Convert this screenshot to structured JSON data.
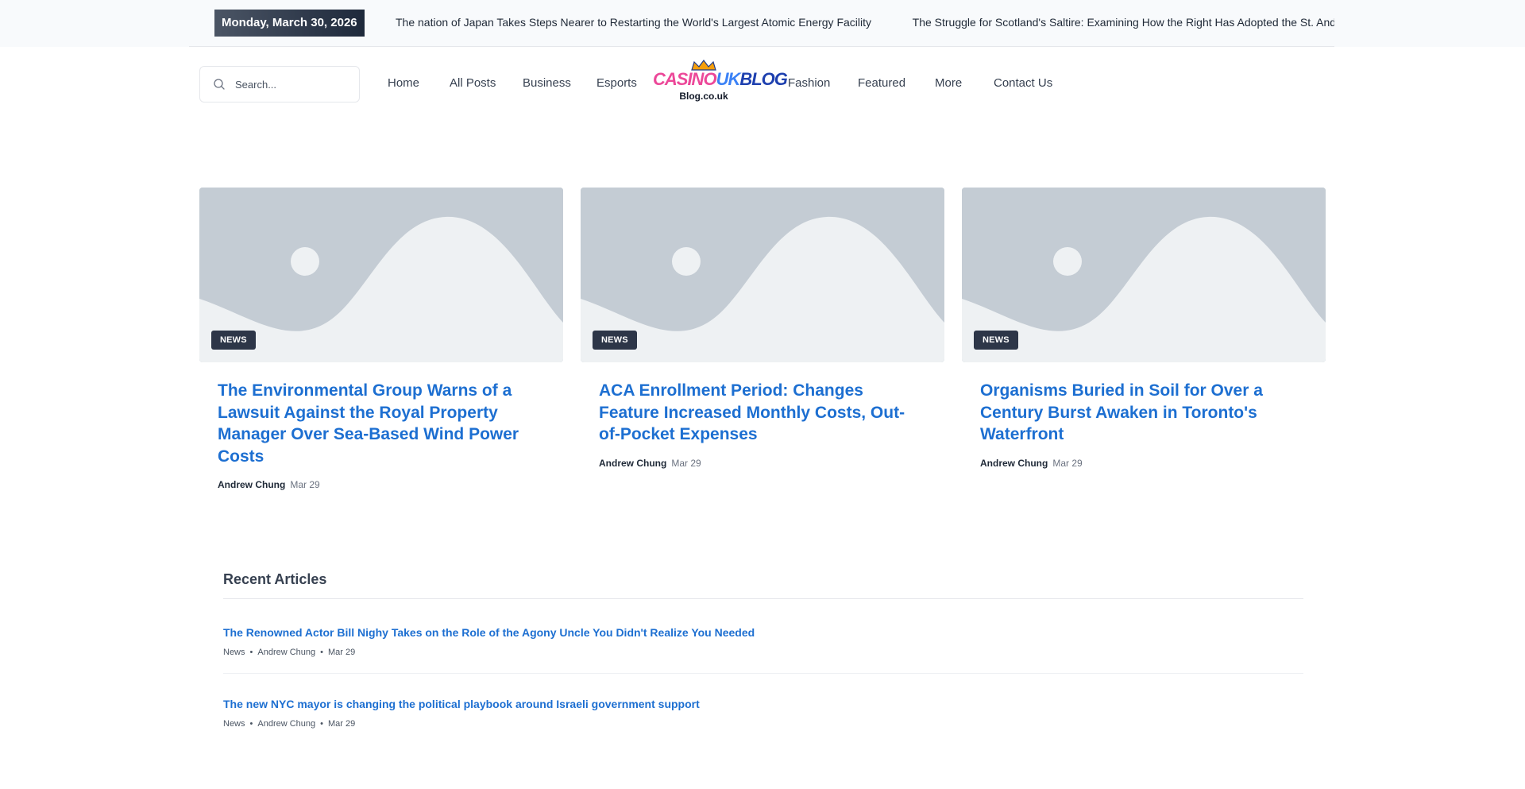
{
  "topbar": {
    "date": "Monday, March 30, 2026",
    "ticker": [
      "The nation of Japan Takes Steps Nearer to Restarting the World's Largest Atomic Energy Facility",
      "The Struggle for Scotland's Saltire: Examining How the Right Has Adopted the St. Andrew's Cros"
    ]
  },
  "search": {
    "placeholder": "Search..."
  },
  "nav": {
    "home": "Home",
    "all_posts": "All Posts",
    "business": "Business",
    "esports": "Esports",
    "fashion": "Fashion",
    "featured": "Featured",
    "more": "More",
    "contact": "Contact Us"
  },
  "logo": {
    "part1": "CASINO",
    "part2": "UK",
    "part3": "BLOG",
    "sub": "Blog.co.uk"
  },
  "cards": [
    {
      "badge": "NEWS",
      "title": "The Environmental Group Warns of a Lawsuit Against the Royal Property Manager Over Sea-Based Wind Power Costs",
      "author": "Andrew Chung",
      "date": "Mar 29"
    },
    {
      "badge": "NEWS",
      "title": "ACA Enrollment Period: Changes Feature Increased Monthly Costs, Out-of-Pocket Expenses",
      "author": "Andrew Chung",
      "date": "Mar 29"
    },
    {
      "badge": "NEWS",
      "title": "Organisms Buried in Soil for Over a Century Burst Awaken in Toronto's Waterfront",
      "author": "Andrew Chung",
      "date": "Mar 29"
    }
  ],
  "recent": {
    "heading": "Recent Articles",
    "separator": "•",
    "items": [
      {
        "title": "The Renowned Actor Bill Nighy Takes on the Role of the Agony Uncle You Didn't Realize You Needed",
        "category": "News",
        "author": "Andrew Chung",
        "date": "Mar 29"
      },
      {
        "title": "The new NYC mayor is changing the political playbook around Israeli government support",
        "category": "News",
        "author": "Andrew Chung",
        "date": "Mar 29"
      }
    ]
  },
  "colors": {
    "link_blue": "#1d6fd1",
    "badge_dark": "#2d3648",
    "placeholder_bg": "#c4ccd4"
  }
}
